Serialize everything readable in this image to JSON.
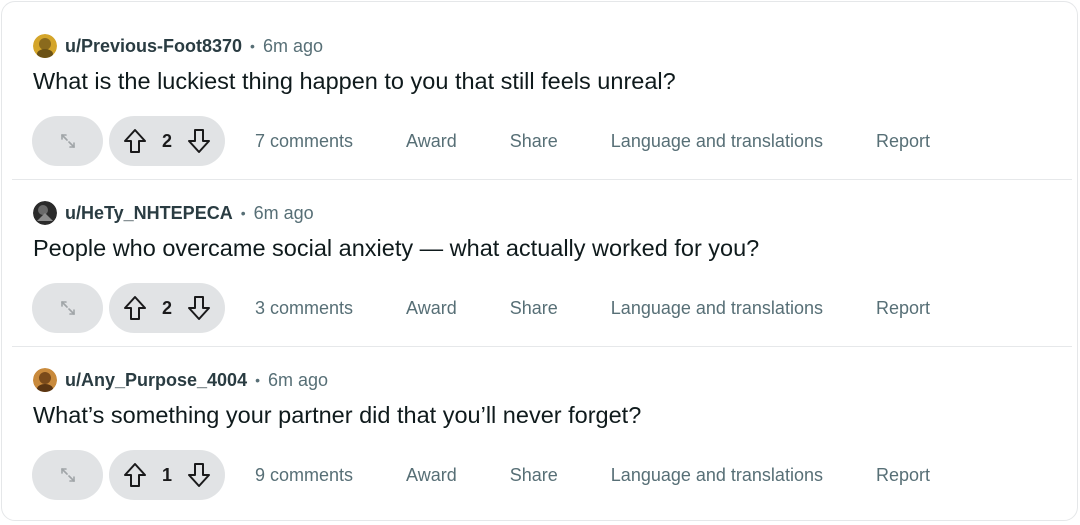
{
  "posts": [
    {
      "author": "u/Previous-Foot8370",
      "time": "6m ago",
      "title": "What is the luckiest thing happen to you that still feels unreal?",
      "votes": "2",
      "comments": "7 comments",
      "avatar_color": "#d4a52a"
    },
    {
      "author": "u/HeTy_NHTEPECA",
      "time": "6m ago",
      "title": "People who overcame social anxiety — what actually worked for you?",
      "votes": "2",
      "comments": "3 comments",
      "avatar_color": "#2b2b2b"
    },
    {
      "author": "u/Any_Purpose_4004",
      "time": "6m ago",
      "title": "What’s something your partner did that you’ll never forget?",
      "votes": "1",
      "comments": "9 comments",
      "avatar_color": "#c98a3c"
    }
  ],
  "labels": {
    "separator": "•",
    "award": "Award",
    "share": "Share",
    "language": "Language and translations",
    "report": "Report"
  },
  "icons": {
    "expand": "expand-icon",
    "upvote": "upvote-arrow-icon",
    "downvote": "downvote-arrow-icon"
  }
}
